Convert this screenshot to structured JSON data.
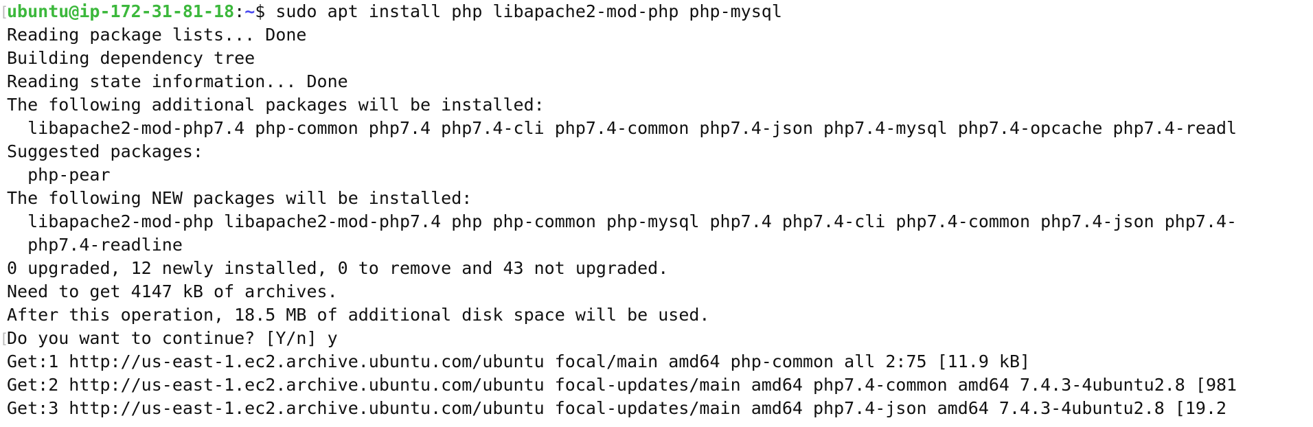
{
  "terminal": {
    "prompt": {
      "user_host": "ubuntu@ip-172-31-81-18",
      "separator": ":",
      "path": "~",
      "symbol": "$ ",
      "command": "sudo apt install php libapache2-mod-php php-mysql"
    },
    "lines": [
      "Reading package lists... Done",
      "Building dependency tree",
      "Reading state information... Done",
      "The following additional packages will be installed:",
      "  libapache2-mod-php7.4 php-common php7.4 php7.4-cli php7.4-common php7.4-json php7.4-mysql php7.4-opcache php7.4-readl",
      "Suggested packages:",
      "  php-pear",
      "The following NEW packages will be installed:",
      "  libapache2-mod-php libapache2-mod-php7.4 php php-common php-mysql php7.4 php7.4-cli php7.4-common php7.4-json php7.4-",
      "  php7.4-readline",
      "0 upgraded, 12 newly installed, 0 to remove and 43 not upgraded.",
      "Need to get 4147 kB of archives.",
      "After this operation, 18.5 MB of additional disk space will be used.",
      "Do you want to continue? [Y/n] y",
      "Get:1 http://us-east-1.ec2.archive.ubuntu.com/ubuntu focal/main amd64 php-common all 2:75 [11.9 kB]",
      "Get:2 http://us-east-1.ec2.archive.ubuntu.com/ubuntu focal-updates/main amd64 php7.4-common amd64 7.4.3-4ubuntu2.8 [981",
      "Get:3 http://us-east-1.ec2.archive.ubuntu.com/ubuntu focal-updates/main amd64 php7.4-json amd64 7.4.3-4ubuntu2.8 [19.2"
    ]
  }
}
